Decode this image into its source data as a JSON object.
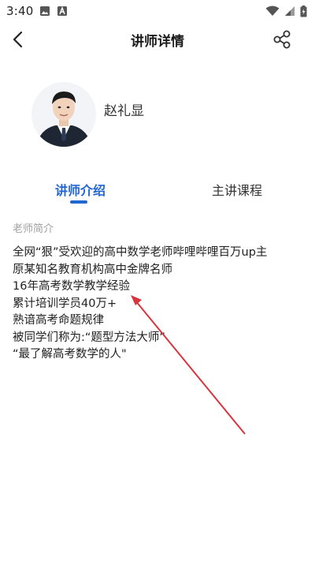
{
  "status_bar": {
    "time": "3:40",
    "icons": [
      "image-icon",
      "font-icon",
      "wifi-icon",
      "signal-icon",
      "battery-icon"
    ]
  },
  "header": {
    "title": "讲师详情",
    "back_icon": "back-arrow-icon",
    "share_icon": "share-icon"
  },
  "profile": {
    "name": "赵礼显"
  },
  "tabs": [
    {
      "label": "讲师介绍",
      "active": true
    },
    {
      "label": "主讲课程",
      "active": false
    }
  ],
  "intro": {
    "section_label": "老师简介",
    "lines": [
      "全网“狠”受欢迎的高中数学老师哔哩哔哩百万up主",
      "原某知名教育机构高中金牌名师",
      "16年高考数学教学经验",
      "累计培训学员40万+",
      "熟谙高考命题规律",
      "被同学们称为:“题型方法大师”",
      "“最了解高考数学的人\""
    ]
  },
  "colors": {
    "accent": "#2266d4",
    "annotation_arrow": "#d9343d"
  }
}
